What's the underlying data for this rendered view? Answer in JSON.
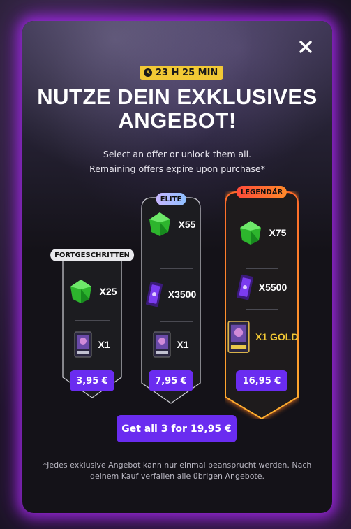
{
  "timer": {
    "text": "23 H 25 MIN",
    "icon": "clock-icon"
  },
  "title": "NUTZE DEIN EXKLUSIVES\nANGEBOT!",
  "subtitle": "Select an offer or unlock them all.\nRemaining offers expire upon purchase*",
  "offers": [
    {
      "badge": "FORTGESCHRITTEN",
      "items": [
        {
          "icon": "green-gem-icon",
          "qty": "X25"
        },
        {
          "icon": "card-pack-icon",
          "qty": "X1"
        }
      ],
      "price": "3,95 €"
    },
    {
      "badge": "ELITE",
      "items": [
        {
          "icon": "green-gem-icon",
          "qty": "X55"
        },
        {
          "icon": "purple-ticket-icon",
          "qty": "X3500"
        },
        {
          "icon": "card-pack-icon",
          "qty": "X1"
        }
      ],
      "price": "7,95 €"
    },
    {
      "badge": "LEGENDÄR",
      "items": [
        {
          "icon": "green-gem-icon",
          "qty": "X75"
        },
        {
          "icon": "purple-ticket-icon",
          "qty": "X5500"
        },
        {
          "icon": "card-pack-icon",
          "qty": "X1 GOLD"
        }
      ],
      "price": "16,95 €"
    }
  ],
  "bundle_button": "Get all 3 for 19,95 €",
  "footnote": "*Jedes exklusive Angebot kann nur einmal beansprucht werden. Nach deinem Kauf verfallen alle übrigen Angebote.",
  "colors": {
    "accent": "#6a2cf0",
    "timer": "#f2c935",
    "glow": "#a028e6",
    "legendary": "#f07a1c",
    "gold_text": "#f2c935"
  }
}
